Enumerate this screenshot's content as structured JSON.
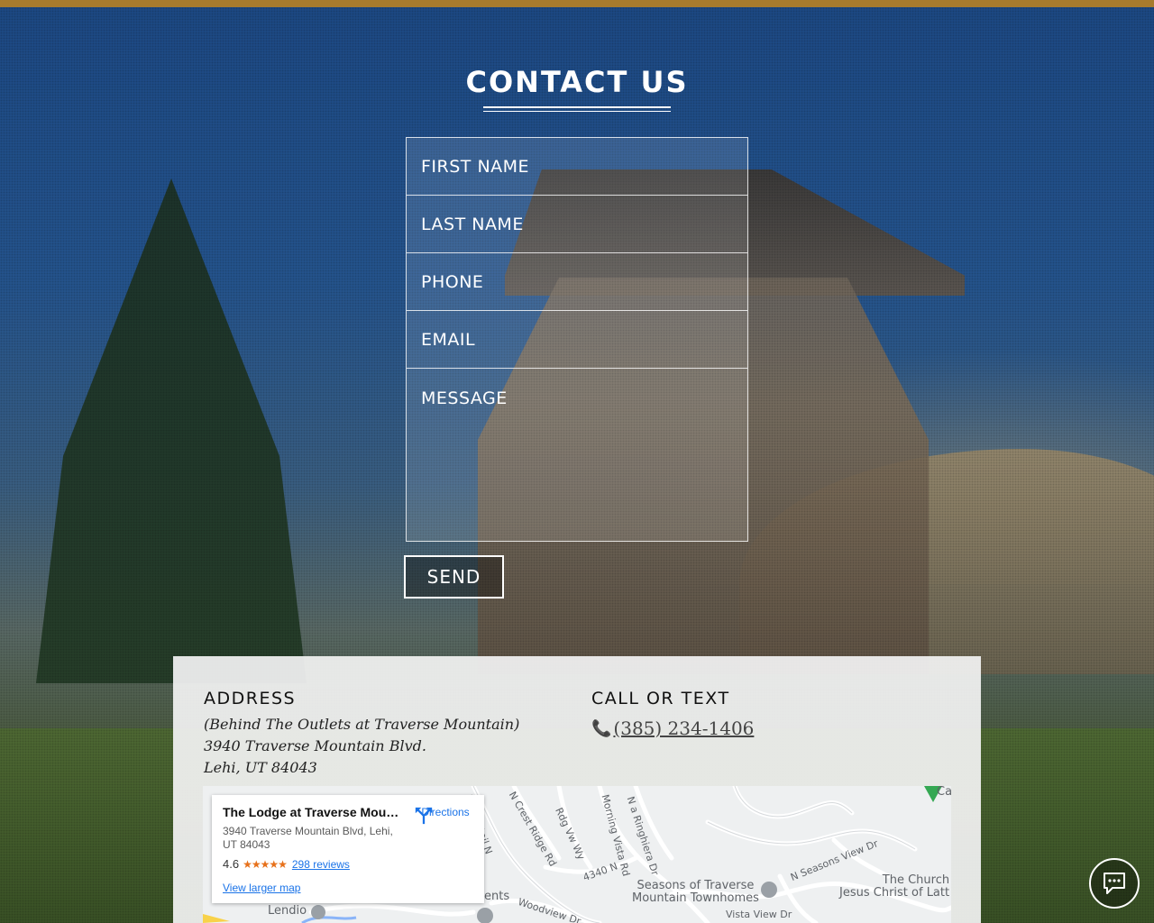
{
  "page": {
    "title": "CONTACT US",
    "accent_color": "#a77b2d"
  },
  "form": {
    "first_name_placeholder": "FIRST NAME",
    "last_name_placeholder": "LAST NAME",
    "phone_placeholder": "PHONE",
    "email_placeholder": "EMAIL",
    "message_placeholder": "MESSAGE",
    "send_label": "SEND"
  },
  "contact": {
    "address_heading": "ADDRESS",
    "address_line1": "(Behind The Outlets at Traverse Mountain)",
    "address_line2": "3940 Traverse Mountain Blvd.",
    "address_line3": "Lehi, UT 84043",
    "call_heading": "CALL OR TEXT",
    "phone": "(385) 234-1406",
    "phone_icon": "phone-icon"
  },
  "map": {
    "place_name": "The Lodge at Traverse Mount…",
    "place_address": "3940 Traverse Mountain Blvd, Lehi, UT 84043",
    "rating": "4.6",
    "stars": "★★★★★",
    "reviews": "298 reviews",
    "directions_label": "Directions",
    "larger_map_label": "View larger map",
    "labels": {
      "ridge_trail": "Ridge Trail N",
      "crest_ridge": "N Crest Ridge Rd",
      "ridge_view": "Rdg Vw Wy",
      "morning_vista": "Morning Vista Rd",
      "ringhiera": "N a Ringhiera Dr",
      "seasons_view": "N Seasons View Dr",
      "n4340": "4340 N",
      "woodview": "Woodview Dr",
      "vista_view": "Vista View Dr",
      "morning_vista_2": "Morning Vista Rd",
      "seasons_poi_1": "Seasons of Traverse",
      "seasons_poi_2": "Mountain Townhomes",
      "church_1": "The Church",
      "church_2": "Jesus Christ of Latt",
      "lendio": "Lendio",
      "ents": "ents",
      "ca": "Ca"
    }
  },
  "chat": {
    "icon": "chat-icon"
  }
}
